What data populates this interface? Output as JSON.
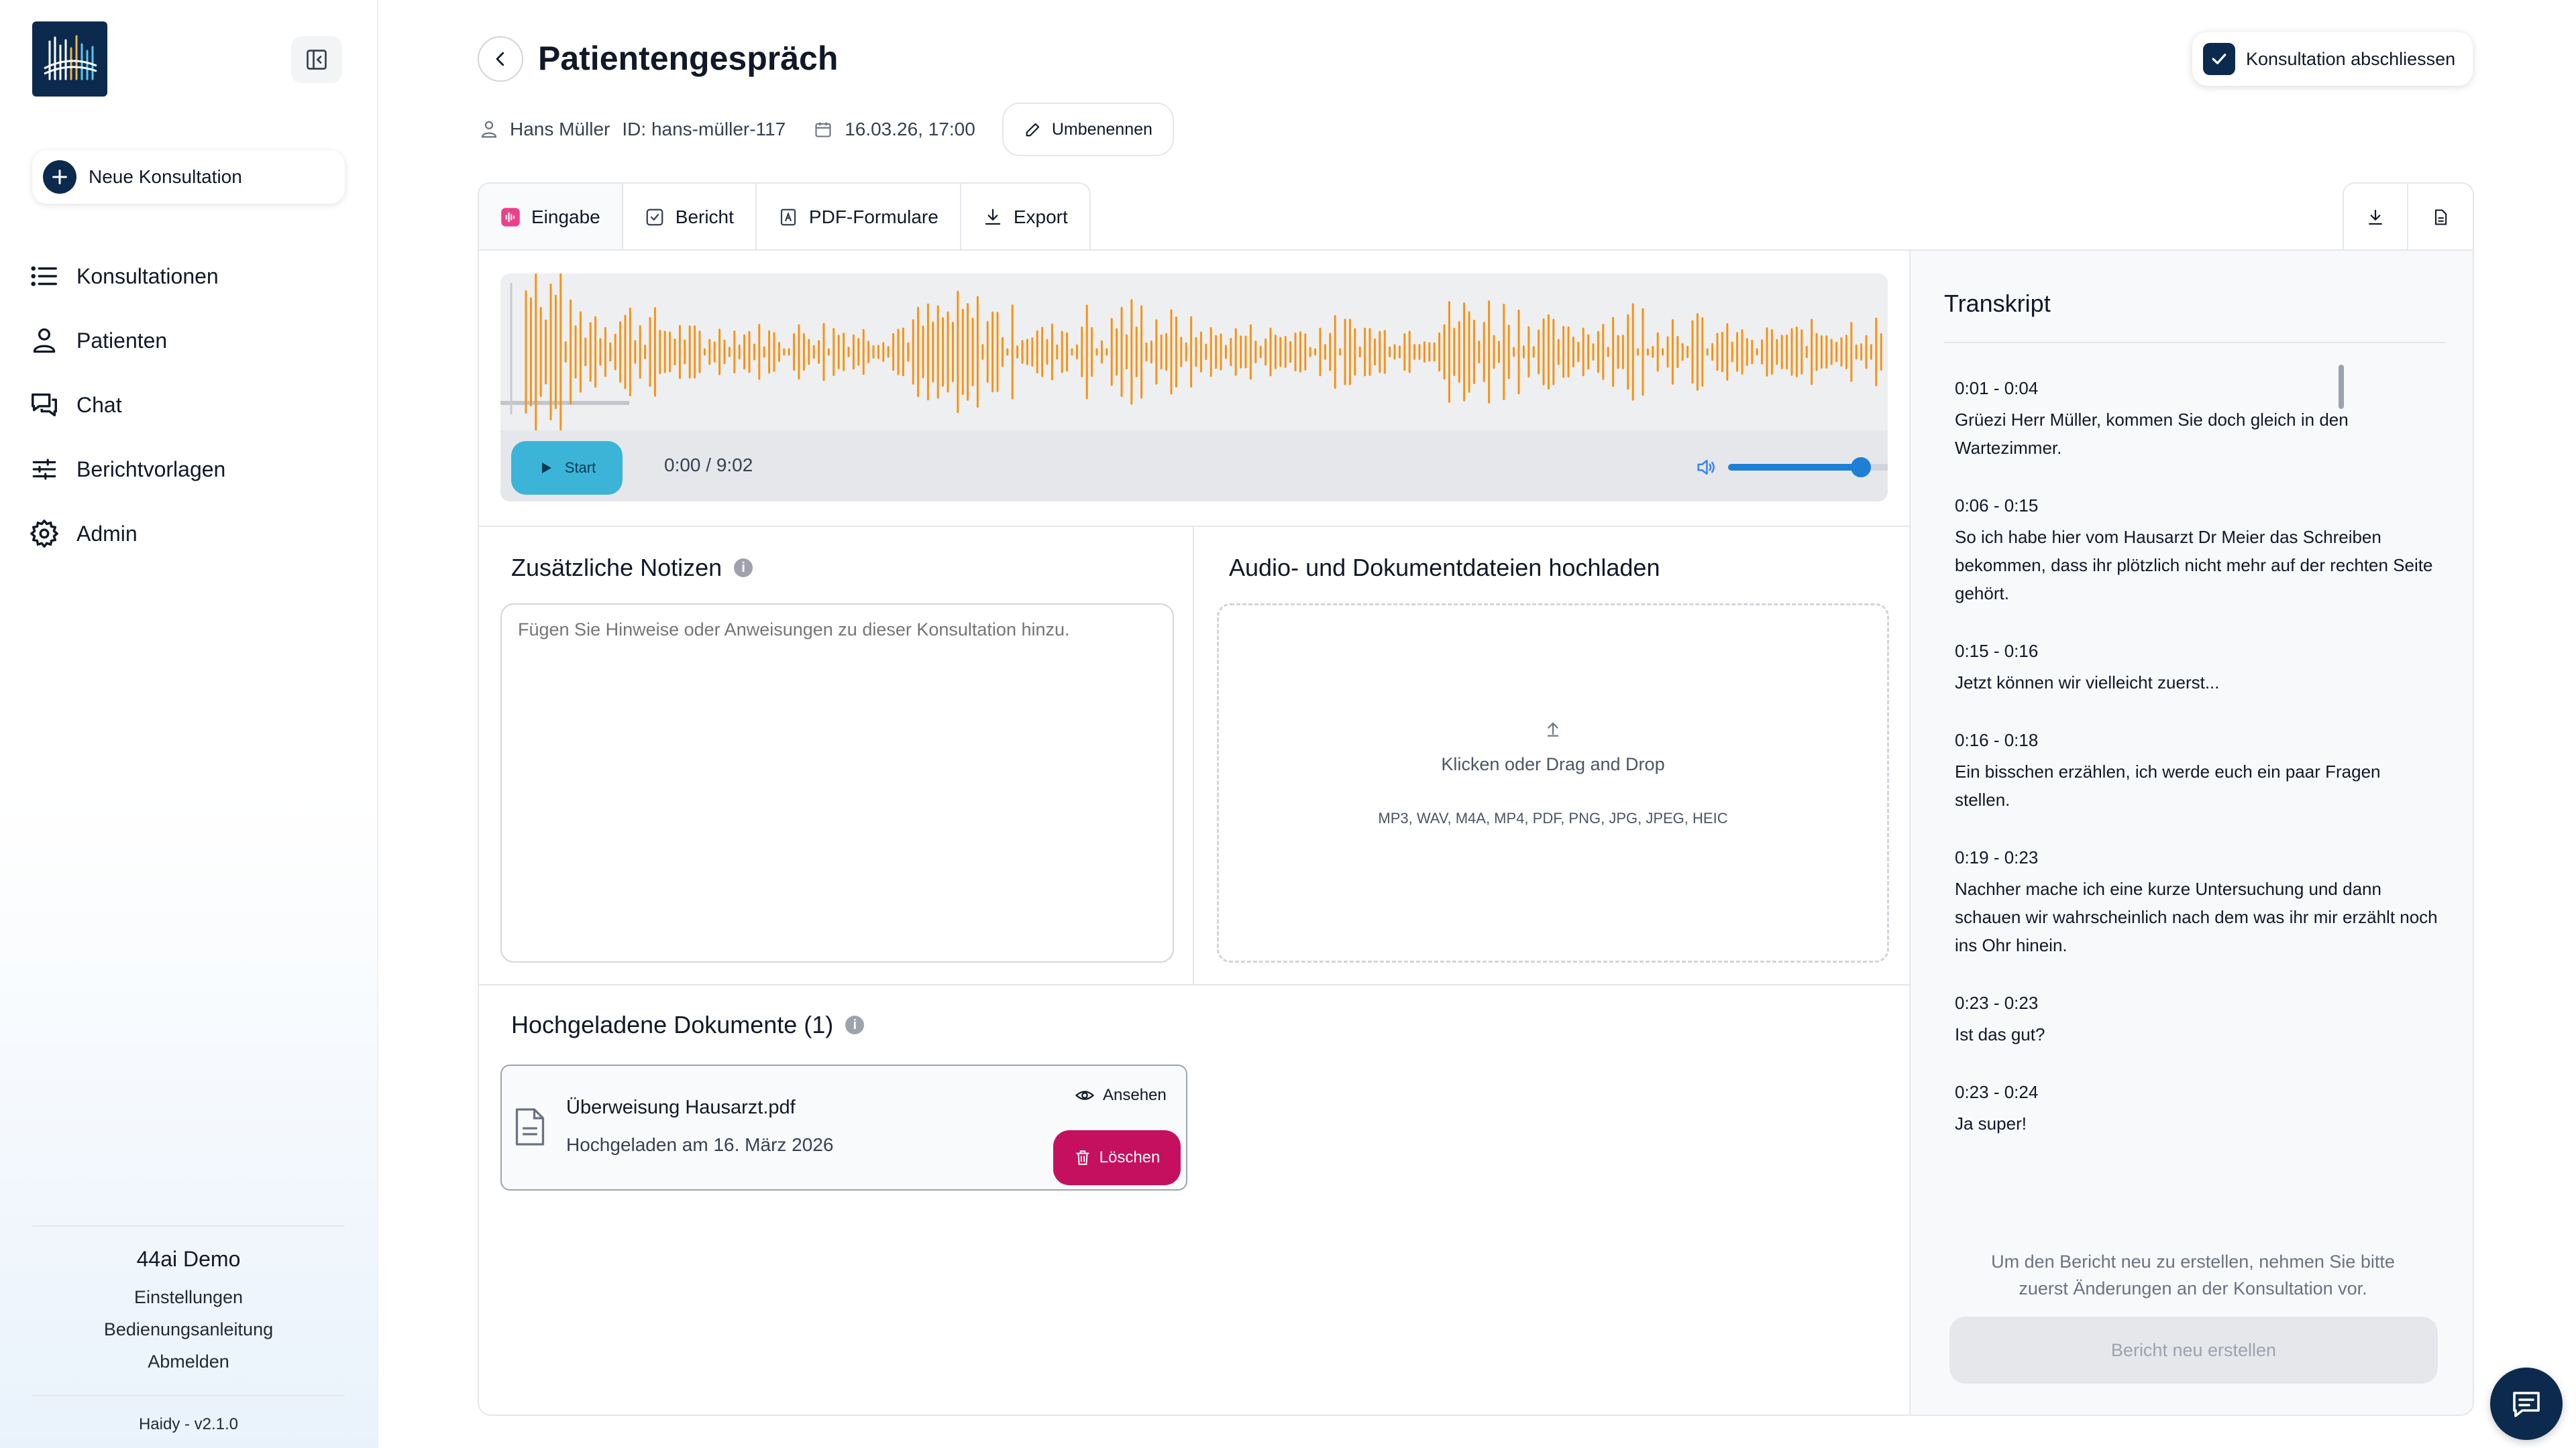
{
  "sidebar": {
    "new_consultation": "Neue Konsultation",
    "items": [
      {
        "label": "Konsultationen",
        "icon": "list-icon"
      },
      {
        "label": "Patienten",
        "icon": "user-icon"
      },
      {
        "label": "Chat",
        "icon": "chat-bubbles-icon"
      },
      {
        "label": "Berichtvorlagen",
        "icon": "sliders-icon"
      },
      {
        "label": "Admin",
        "icon": "gear-icon"
      }
    ],
    "footer": {
      "org": "44ai Demo",
      "links": [
        "Einstellungen",
        "Bedienungsanleitung",
        "Abmelden"
      ],
      "version": "Haidy - v2.1.0"
    }
  },
  "header": {
    "title": "Patientengespräch",
    "patient_name": "Hans Müller",
    "patient_id": "ID: hans-müller-117",
    "datetime": "16.03.26, 17:00",
    "rename": "Umbenennen",
    "finish": "Konsultation abschliessen"
  },
  "tabs": [
    {
      "label": "Eingabe",
      "active": true
    },
    {
      "label": "Bericht",
      "active": false
    },
    {
      "label": "PDF-Formulare",
      "active": false
    },
    {
      "label": "Export",
      "active": false
    }
  ],
  "audio": {
    "play_label": "Start",
    "time": "0:00 / 9:02",
    "volume": 0.78,
    "wave_color": "#f59315"
  },
  "notes": {
    "title": "Zusätzliche Notizen",
    "placeholder": "Fügen Sie Hinweise oder Anweisungen zu dieser Konsultation hinzu."
  },
  "upload": {
    "title": "Audio- und Dokumentdateien hochladen",
    "prompt": "Klicken oder Drag and Drop",
    "formats": "MP3, WAV, M4A, MP4, PDF, PNG, JPG, JPEG, HEIC"
  },
  "documents": {
    "title": "Hochgeladene Dokumente (1)",
    "items": [
      {
        "name": "Überweisung Hausarzt.pdf",
        "uploaded": "Hochgeladen am 16. März 2026",
        "view": "Ansehen",
        "delete": "Löschen"
      }
    ]
  },
  "transcript": {
    "title": "Transkript",
    "entries": [
      {
        "time": "0:01 - 0:04",
        "text": "Grüezi Herr Müller, kommen Sie doch gleich in den Wartezimmer."
      },
      {
        "time": "0:06 - 0:15",
        "text": "So ich habe hier vom Hausarzt Dr Meier das Schreiben bekommen, dass ihr plötzlich nicht mehr auf der rechten Seite gehört."
      },
      {
        "time": "0:15 - 0:16",
        "text": "Jetzt können wir vielleicht zuerst..."
      },
      {
        "time": "0:16 - 0:18",
        "text": "Ein bisschen erzählen, ich werde euch ein paar Fragen stellen."
      },
      {
        "time": "0:19 - 0:23",
        "text": "Nachher mache ich eine kurze Untersuchung und dann schauen wir wahrscheinlich nach dem was ihr mir erzählt noch ins Ohr hinein."
      },
      {
        "time": "0:23 - 0:23",
        "text": "Ist das gut?"
      },
      {
        "time": "0:23 - 0:24",
        "text": "Ja super!"
      }
    ],
    "hint": "Um den Bericht neu zu erstellen, nehmen Sie bitte zuerst Änderungen an der Konsultation vor.",
    "regenerate": "Bericht neu erstellen"
  },
  "colors": {
    "brand": "#0c2a4d",
    "play": "#3bb4d8",
    "delete": "#c5105f",
    "volume": "#1e7fd6"
  }
}
